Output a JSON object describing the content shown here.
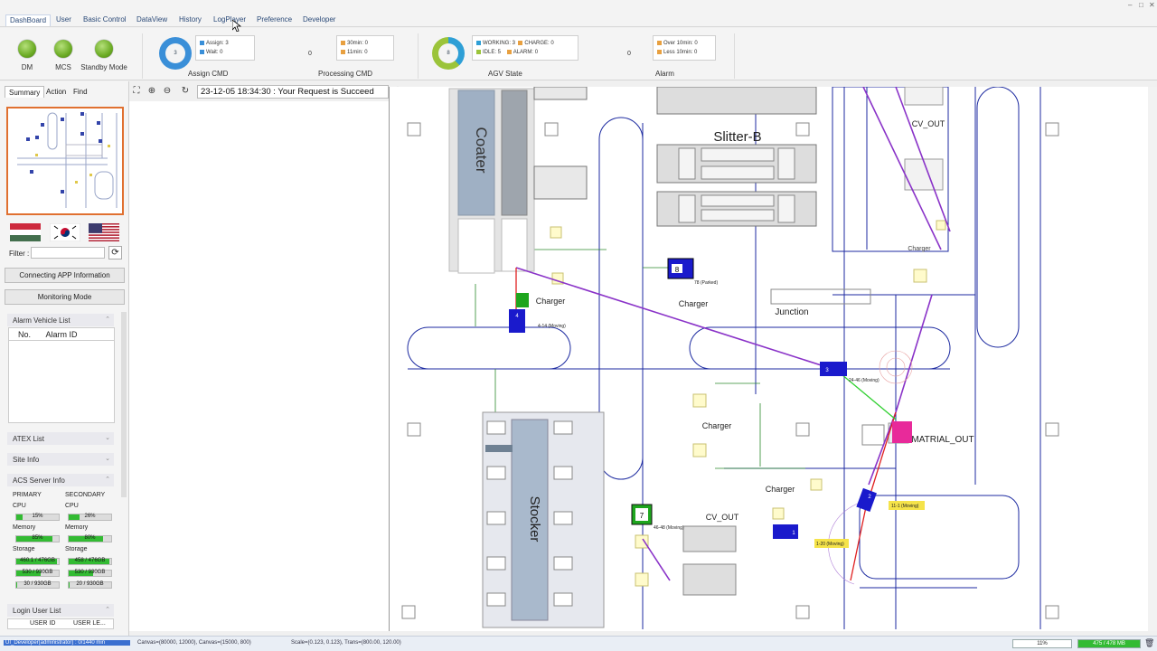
{
  "menu": [
    "DashBoard",
    "User",
    "Basic Control",
    "DataView",
    "History",
    "LogPlayer",
    "Preference",
    "Developer"
  ],
  "status_leds": [
    "DM",
    "MCS",
    "Standby Mode"
  ],
  "assign_cmd": {
    "ring_value": "3",
    "assign": "Assign: 3",
    "wait": "Wait: 0",
    "label": "Assign CMD",
    "color": "#3a8fd8"
  },
  "processing_cmd": {
    "count": "0",
    "over30": "30min: 0",
    "over11": "11min: 0",
    "label": "Processing CMD"
  },
  "agv_state": {
    "ring_value": "8",
    "working": "WORKING: 3",
    "idle": "IDLE: 5",
    "charge": "CHARGE: 0",
    "alarm": "ALARM: 0",
    "label": "AGV State",
    "color": "#2e9fd6",
    "accent": "#9bc43a"
  },
  "alarm_summary": {
    "count": "0",
    "over10": "Over 10min: 0",
    "less10": "Less 10min: 0",
    "label": "Alarm"
  },
  "left_tabs": [
    "Summary",
    "Action",
    "Find"
  ],
  "filter_label": "Filter :",
  "buttons": {
    "connecting": "Connecting APP Information",
    "monitoring": "Monitoring Mode"
  },
  "sections": {
    "alarm_vehicle": "Alarm Vehicle List",
    "atex": "ATEX List",
    "site": "Site Info",
    "acs": "ACS Server Info",
    "login": "Login User List"
  },
  "alarm_table": {
    "col_no": "No.",
    "col_id": "Alarm ID"
  },
  "acs": {
    "primary": "PRIMARY",
    "secondary": "SECONDARY",
    "cpu": "CPU",
    "memory": "Memory",
    "storage": "Storage",
    "primary_cpu": {
      "pct": 15,
      "text": "15%"
    },
    "secondary_cpu": {
      "pct": 26,
      "text": "26%"
    },
    "primary_mem": {
      "pct": 85,
      "text": "85%"
    },
    "secondary_mem": {
      "pct": 80,
      "text": "80%"
    },
    "primary_storage": [
      {
        "pct": 96,
        "text": "460.1 / 476GB"
      },
      {
        "pct": 57,
        "text": "530 / 930GB"
      },
      {
        "pct": 3,
        "text": "30 / 930GB"
      }
    ],
    "secondary_storage": [
      {
        "pct": 96,
        "text": "458 / 476GB"
      },
      {
        "pct": 57,
        "text": "530 / 930GB"
      },
      {
        "pct": 2,
        "text": "20 / 930GB"
      }
    ]
  },
  "login_cols": {
    "id": "USER ID",
    "level": "USER LE..."
  },
  "status_message": "23-12-05 18:34:30 : Your Request is Succeed",
  "map_labels": {
    "coater": "Coater",
    "slitter": "Slitter-B",
    "stocker": "Stocker",
    "junction": "Junction",
    "cv_out_top": "CV_OUT",
    "cv_out_bottom": "CV_OUT",
    "matrial_out": "MATRIAL_OUT",
    "charger": "Charger"
  },
  "vehicles": [
    {
      "id": "8",
      "color": "#1a1acc",
      "status": "78 (Parked)"
    },
    {
      "id": "4",
      "color": "#1a1acc",
      "status": "4-14 (Moving)"
    },
    {
      "id": "3",
      "color": "#1a1acc",
      "status": "24-46 (Moving)"
    },
    {
      "id": "2",
      "color": "#1a1acc",
      "status": "11-1 (Moving)"
    },
    {
      "id": "1",
      "color": "#1a1acc",
      "status": "1-20 (Moving)"
    },
    {
      "id": "7",
      "color": "#1ea61e",
      "status": "46-48 (Moving)"
    }
  ],
  "statusbar": {
    "user": "UI_Developer(administrator) : 0/1440 min",
    "canvas": "Canvas=(80000, 12000), Canvas=(15000, 800)",
    "scale": "Scale=(0.123, 0.123), Trans=(800.00, 120.00)",
    "zoom": "11%",
    "memory": "475 / 478 MB"
  }
}
